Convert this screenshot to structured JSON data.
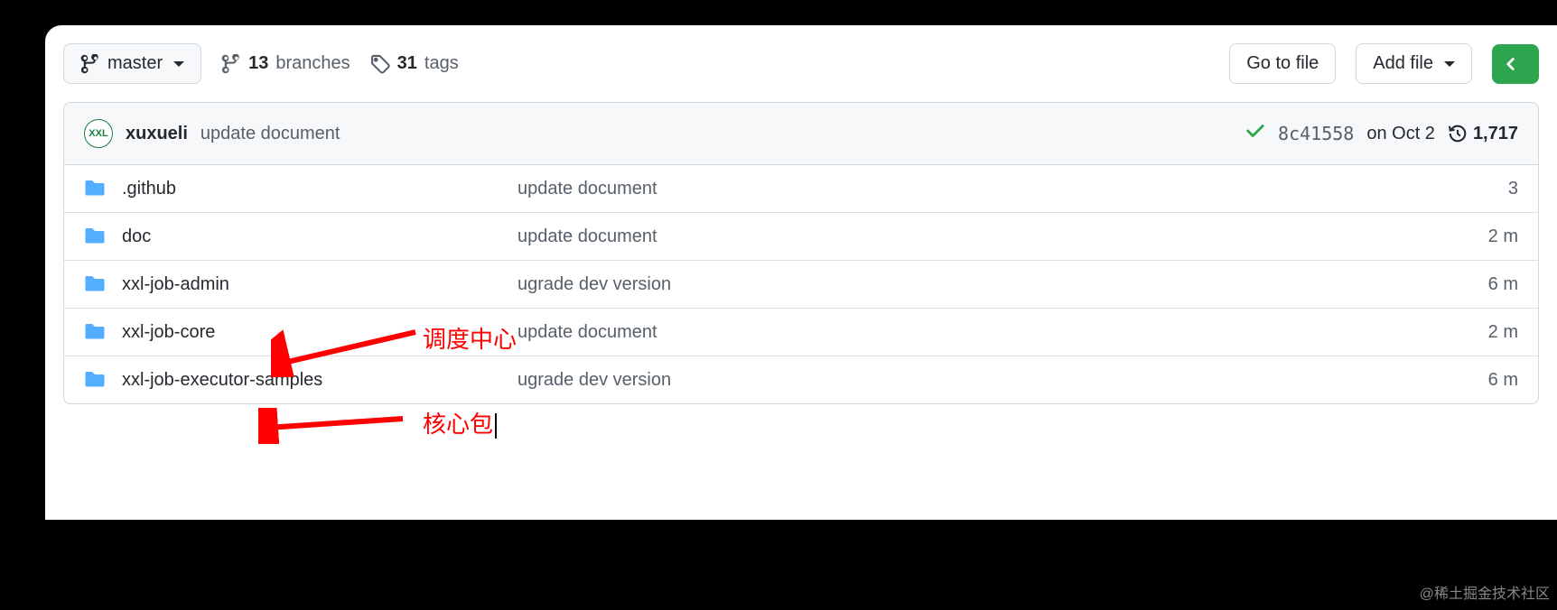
{
  "toolbar": {
    "branch_label": "master",
    "branches_count": "13",
    "branches_word": "branches",
    "tags_count": "31",
    "tags_word": "tags",
    "go_to_file": "Go to file",
    "add_file": "Add file"
  },
  "summary": {
    "avatar_text": "XXL",
    "author": "xuxueli",
    "message": "update document",
    "sha": "8c41558",
    "date": "on Oct 2",
    "commits_count": "1,717"
  },
  "rows": [
    {
      "name": ".github",
      "commit": "update document",
      "age": "3"
    },
    {
      "name": "doc",
      "commit": "update document",
      "age": "2 m"
    },
    {
      "name": "xxl-job-admin",
      "commit": "ugrade dev version",
      "age": "6 m"
    },
    {
      "name": "xxl-job-core",
      "commit": "update document",
      "age": "2 m"
    },
    {
      "name": "xxl-job-executor-samples",
      "commit": "ugrade dev version",
      "age": "6 m"
    }
  ],
  "annotations": {
    "label1": "调度中心",
    "label2": "核心包"
  },
  "watermark": "@稀土掘金技术社区"
}
